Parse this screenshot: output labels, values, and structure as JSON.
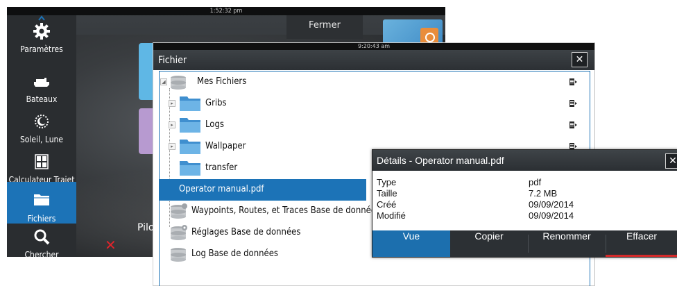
{
  "back_screen": {
    "status_time": "1:52:32 pm",
    "close_button": "Fermer",
    "partial_label": "Pilo"
  },
  "sidebar": {
    "items": [
      {
        "label": "Paramètres",
        "icon": "gear-icon"
      },
      {
        "label": "Bateaux",
        "icon": "boat-icon"
      },
      {
        "label": "Soleil, Lune",
        "icon": "sun-moon-icon"
      },
      {
        "label": "Calculateur Trajet",
        "icon": "calculator-icon"
      },
      {
        "label": "Fichiers",
        "icon": "folder-icon",
        "active": true
      },
      {
        "label": "Chercher",
        "icon": "search-icon"
      }
    ]
  },
  "file_dialog": {
    "status_time": "9:20:43 am",
    "title": "Fichier",
    "rows": [
      {
        "name": "Mes Fichiers",
        "type": "database",
        "expanded": true
      },
      {
        "name": "Gribs",
        "type": "folder"
      },
      {
        "name": "Logs",
        "type": "folder"
      },
      {
        "name": "Wallpaper",
        "type": "folder"
      },
      {
        "name": "transfer",
        "type": "folder"
      },
      {
        "name": "Operator manual.pdf",
        "type": "file",
        "selected": true
      },
      {
        "name": "Waypoints, Routes, et Traces Base de données",
        "type": "database"
      },
      {
        "name": "Réglages Base de données",
        "type": "database"
      },
      {
        "name": "Log Base de données",
        "type": "database"
      }
    ]
  },
  "details": {
    "title": "Détails - Operator manual.pdf",
    "properties": [
      {
        "label": "Type",
        "value": "pdf"
      },
      {
        "label": "Taille",
        "value": "7.2 MB"
      },
      {
        "label": "Créé",
        "value": "09/09/2014"
      },
      {
        "label": "Modifié",
        "value": "09/09/2014"
      }
    ],
    "actions": [
      {
        "label": "Vue",
        "selected": true
      },
      {
        "label": "Copier"
      },
      {
        "label": "Renommer"
      },
      {
        "label": "Effacer",
        "destructive": true
      }
    ]
  },
  "colors": {
    "accent_blue": "#1c73b7",
    "dark_header": "#2c3034",
    "destructive_red": "#d42a2a",
    "folder_blue": "#5aa6dc"
  }
}
